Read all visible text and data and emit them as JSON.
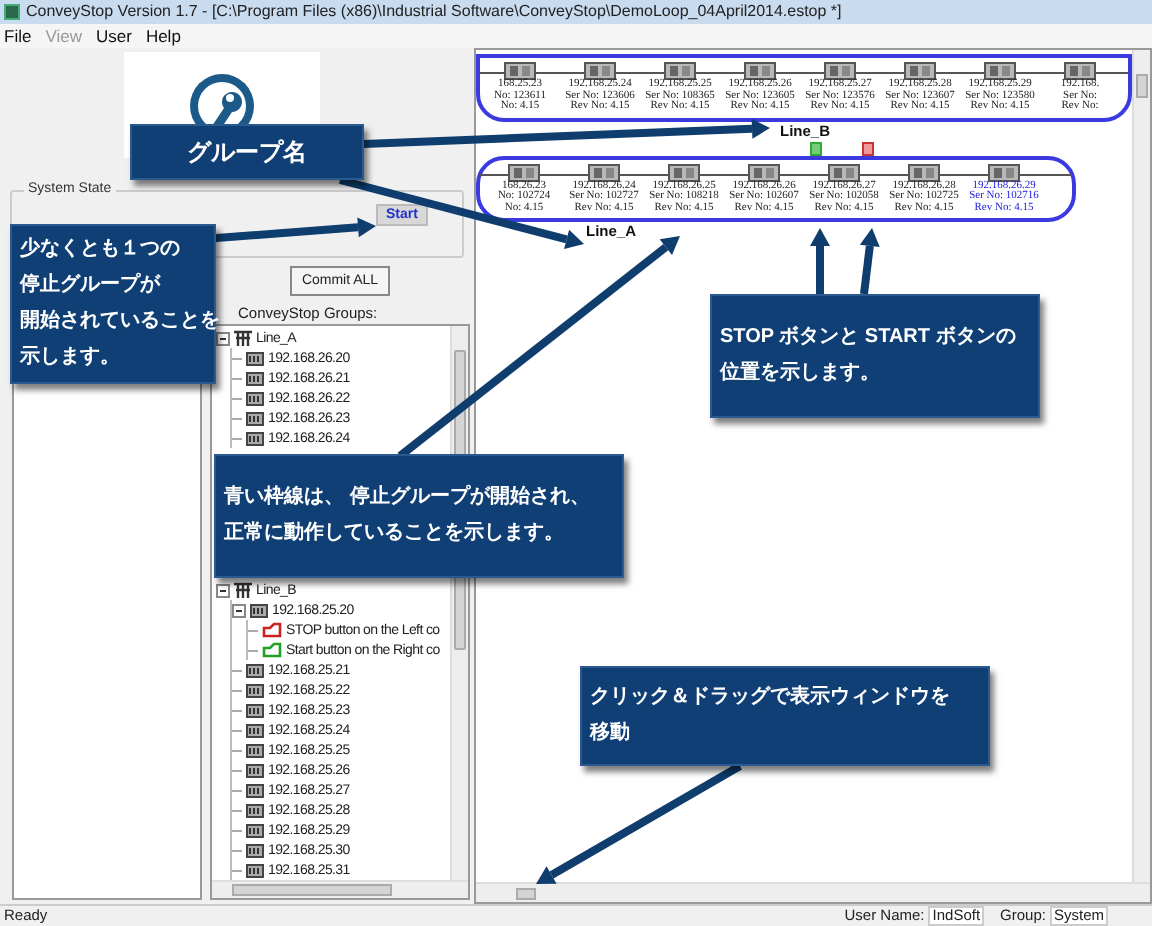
{
  "window": {
    "title": "ConveyStop Version 1.7 - [C:\\Program Files (x86)\\Industrial Software\\ConveyStop\\DemoLoop_04April2014.estop *]"
  },
  "menu": [
    {
      "label": "File",
      "disabled": false
    },
    {
      "label": "View",
      "disabled": true
    },
    {
      "label": "User",
      "disabled": false
    },
    {
      "label": "Help",
      "disabled": false
    }
  ],
  "system_state": {
    "title": "System State",
    "button": "Start"
  },
  "commit_button": "Commit ALL",
  "groups_label": "ConveyStop Groups:",
  "tree": [
    {
      "label": "Line_A",
      "kind": "line",
      "expanded": true,
      "children": [
        {
          "label": "192.168.26.20",
          "kind": "device"
        },
        {
          "label": "192.168.26.21",
          "kind": "device"
        },
        {
          "label": "192.168.26.22",
          "kind": "device"
        },
        {
          "label": "192.168.26.23",
          "kind": "device"
        },
        {
          "label": "192.168.26.24",
          "kind": "device"
        }
      ]
    },
    {
      "label": "Line_B",
      "kind": "line",
      "expanded": true,
      "children": [
        {
          "label": "192.168.25.20",
          "kind": "device",
          "expanded": true,
          "children": [
            {
              "label": "STOP button on the Left co",
              "kind": "stop"
            },
            {
              "label": "Start button on the Right co",
              "kind": "start"
            }
          ]
        },
        {
          "label": "192.168.25.21",
          "kind": "device"
        },
        {
          "label": "192.168.25.22",
          "kind": "device"
        },
        {
          "label": "192.168.25.23",
          "kind": "device"
        },
        {
          "label": "192.168.25.24",
          "kind": "device"
        },
        {
          "label": "192.168.25.25",
          "kind": "device"
        },
        {
          "label": "192.168.25.26",
          "kind": "device"
        },
        {
          "label": "192.168.25.27",
          "kind": "device"
        },
        {
          "label": "192.168.25.28",
          "kind": "device"
        },
        {
          "label": "192.168.25.29",
          "kind": "device"
        },
        {
          "label": "192.168.25.30",
          "kind": "device"
        },
        {
          "label": "192.168.25.31",
          "kind": "device"
        }
      ]
    }
  ],
  "canvas": {
    "lines": [
      {
        "name": "Line_B",
        "running": true,
        "devices": [
          {
            "ip": "168.25.23",
            "serial": "No: 123611",
            "rev": "No: 4.15",
            "selected": false
          },
          {
            "ip": "192.168.25.24",
            "serial": "Ser No: 123606",
            "rev": "Rev No: 4.15",
            "selected": false
          },
          {
            "ip": "192.168.25.25",
            "serial": "Ser No: 108365",
            "rev": "Rev No: 4.15",
            "selected": false
          },
          {
            "ip": "192.168.25.26",
            "serial": "Ser No: 123605",
            "rev": "Rev No: 4.15",
            "selected": false
          },
          {
            "ip": "192.168.25.27",
            "serial": "Ser No: 123576",
            "rev": "Rev No: 4.15",
            "selected": false
          },
          {
            "ip": "192.168.25.28",
            "serial": "Ser No: 123607",
            "rev": "Rev No: 4.15",
            "selected": false
          },
          {
            "ip": "192.168.25.29",
            "serial": "Ser No: 123580",
            "rev": "Rev No: 4.15",
            "selected": false
          },
          {
            "ip": "192.168.",
            "serial": "Ser No:",
            "rev": "Rev No:",
            "selected": false
          }
        ]
      },
      {
        "name": "Line_A",
        "running": true,
        "markers": [
          {
            "kind": "start"
          },
          {
            "kind": "stop"
          }
        ],
        "devices": [
          {
            "ip": "168.26.23",
            "serial": "No: 102724",
            "rev": "No: 4.15",
            "selected": false
          },
          {
            "ip": "192.168.26.24",
            "serial": "Ser No: 102727",
            "rev": "Rev No: 4.15",
            "selected": false
          },
          {
            "ip": "192.168.26.25",
            "serial": "Ser No: 108218",
            "rev": "Rev No: 4.15",
            "selected": false
          },
          {
            "ip": "192.168.26.26",
            "serial": "Ser No: 102607",
            "rev": "Rev No: 4.15",
            "selected": false
          },
          {
            "ip": "192.168.26.27",
            "serial": "Ser No: 102058",
            "rev": "Rev No: 4.15",
            "selected": false
          },
          {
            "ip": "192.168.26.28",
            "serial": "Ser No: 102725",
            "rev": "Rev No: 4.15",
            "selected": false
          },
          {
            "ip": "192.168.26.29",
            "serial": "Ser No: 102716",
            "rev": "Rev No: 4.15",
            "selected": true
          }
        ]
      }
    ]
  },
  "callouts": [
    {
      "lines": [
        "グループ名"
      ]
    },
    {
      "lines": [
        "少なくとも１つの",
        "停止グループが",
        "開始されていることを",
        "示します。"
      ]
    },
    {
      "lines": [
        "青い枠線は、 停止グループが開始され、",
        "正常に動作していることを示します。"
      ]
    },
    {
      "lines": [
        "STOP ボタンと START ボタンの",
        "位置を示します。"
      ]
    },
    {
      "lines": [
        "クリック＆ドラッグで表示ウィンドウを",
        "移動"
      ]
    }
  ],
  "status_bar": {
    "text": "Ready",
    "user_label": "User Name:",
    "user": "IndSoft",
    "group_label": "Group:",
    "group": "System"
  }
}
